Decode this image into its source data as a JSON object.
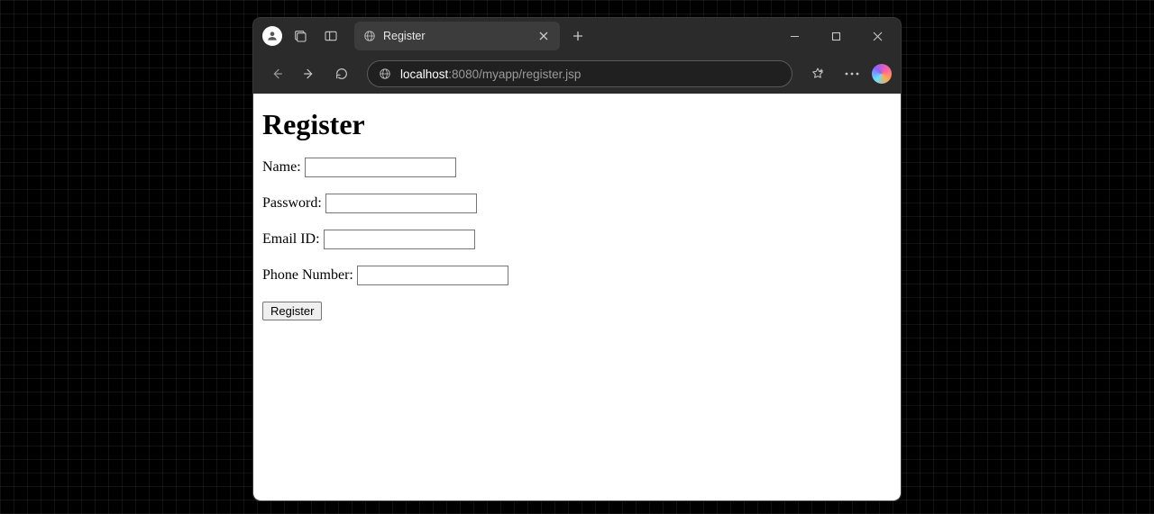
{
  "browser": {
    "tab_title": "Register",
    "url_host": "localhost",
    "url_port_path": ":8080/myapp/register.jsp"
  },
  "page": {
    "heading": "Register",
    "fields": {
      "name_label": "Name:",
      "password_label": "Password:",
      "email_label": "Email ID:",
      "phone_label": "Phone Number:"
    },
    "submit_label": "Register"
  }
}
